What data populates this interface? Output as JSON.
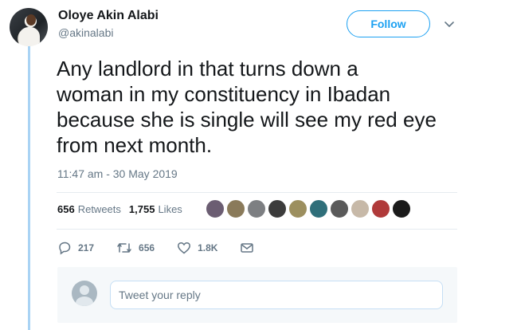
{
  "user": {
    "name": "Oloye Akin Alabi",
    "handle": "@akinalabi"
  },
  "follow_label": "Follow",
  "tweet": {
    "lines": [
      "Any landlord in that turns down a",
      "woman in my constituency in Ibadan",
      "because she is single will see my red eye",
      "from next month."
    ],
    "timestamp": "11:47 am - 30 May 2019"
  },
  "stats": {
    "retweets_count": "656",
    "retweets_label": "Retweets",
    "likes_count": "1,755",
    "likes_label": "Likes"
  },
  "likers": [
    {
      "color": "#6b5d72"
    },
    {
      "color": "#8a7a5a"
    },
    {
      "color": "#7d7f82"
    },
    {
      "color": "#3c3c3c"
    },
    {
      "color": "#9c8f5f"
    },
    {
      "color": "#2f6f7a"
    },
    {
      "color": "#5a5a5a"
    },
    {
      "color": "#c7b9a8"
    },
    {
      "color": "#b03a3a"
    },
    {
      "color": "#1b1b1b"
    }
  ],
  "actions": {
    "replies": "217",
    "retweets": "656",
    "likes": "1.8K"
  },
  "reply": {
    "placeholder": "Tweet your reply"
  },
  "colors": {
    "accent": "#1da1f2",
    "thread_line": "#a9d3f4",
    "muted": "#657786"
  }
}
